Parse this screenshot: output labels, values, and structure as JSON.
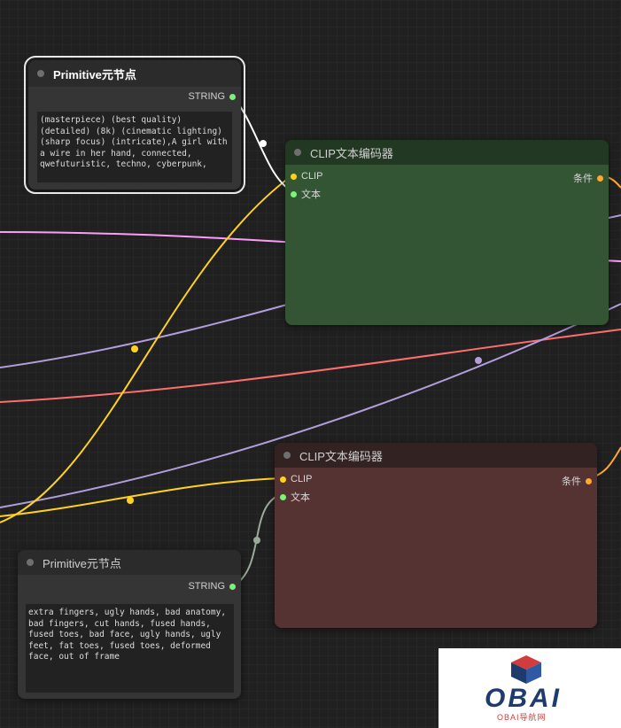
{
  "colors": {
    "canvas_bg": "#202020",
    "wire_string": "#ffffff",
    "wire_clip": "#ffd21f",
    "wire_conditioning": "#ffa931",
    "wire_latent": "#ff9cf9",
    "wire_model": "#b39ddb",
    "wire_vae": "#ff6e6e",
    "positive_node": "#335533",
    "negative_node": "#553333"
  },
  "nodes": {
    "primitive_positive": {
      "title": "Primitive元节点",
      "output_label": "STRING",
      "text": "(masterpiece) (best quality) (detailed) (8k) (cinematic lighting) (sharp focus) (intricate),A girl with a wire in her hand, connected, qwefuturistic, techno, cyberpunk,"
    },
    "clip_positive": {
      "title": "CLIP文本编码器",
      "input_clip": "CLIP",
      "input_text": "文本",
      "output_label": "条件"
    },
    "clip_negative": {
      "title": "CLIP文本编码器",
      "input_clip": "CLIP",
      "input_text": "文本",
      "output_label": "条件"
    },
    "primitive_negative": {
      "title": "Primitive元节点",
      "output_label": "STRING",
      "text": "extra fingers, ugly hands, bad anatomy, bad fingers, cut hands, fused hands, fused toes, bad face, ugly hands, ugly feet, fat toes, fused toes, deformed face, out of frame"
    }
  },
  "watermark": {
    "logo": "OBAI",
    "subtitle": "OBAI导航网"
  }
}
